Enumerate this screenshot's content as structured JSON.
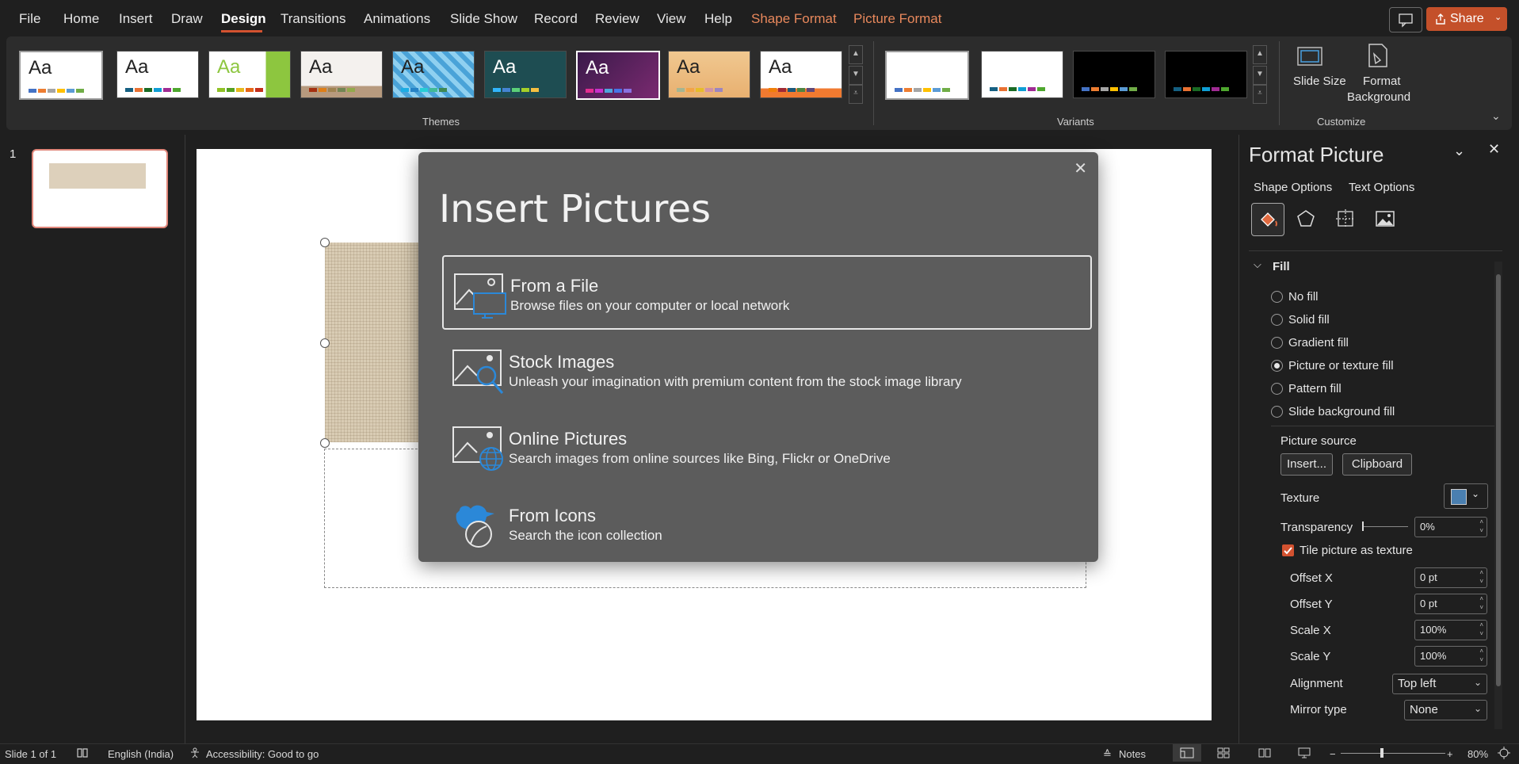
{
  "menu": {
    "items": [
      "File",
      "Home",
      "Insert",
      "Draw",
      "Design",
      "Transitions",
      "Animations",
      "Slide Show",
      "Record",
      "Review",
      "View",
      "Help"
    ],
    "contextual": [
      "Shape Format",
      "Picture Format"
    ],
    "active": "Design",
    "share_label": "Share"
  },
  "ribbon": {
    "themes_label": "Themes",
    "variants_label": "Variants",
    "customize_label": "Customize",
    "theme_aa": "Aa",
    "slide_size_label": "Slide Size",
    "format_background_label1": "Format",
    "format_background_label2": "Background"
  },
  "slides": {
    "number": "1"
  },
  "dialog": {
    "title": "Insert Pictures",
    "options": [
      {
        "title": "From a File",
        "desc": "Browse files on your computer or local network",
        "icon": "file-picture-icon"
      },
      {
        "title": "Stock Images",
        "desc": "Unleash your imagination with premium content from the stock image library",
        "icon": "stock-images-icon"
      },
      {
        "title": "Online Pictures",
        "desc": "Search images from online sources like Bing, Flickr or OneDrive",
        "icon": "online-pictures-icon"
      },
      {
        "title": "From Icons",
        "desc": "Search the icon collection",
        "icon": "icons-icon"
      }
    ]
  },
  "pane": {
    "title": "Format Picture",
    "shape_options": "Shape Options",
    "text_options": "Text Options",
    "fill_header": "Fill",
    "fills": [
      {
        "label": "No fill",
        "checked": false
      },
      {
        "label": "Solid fill",
        "checked": false
      },
      {
        "label": "Gradient fill",
        "checked": false
      },
      {
        "label": "Picture or texture fill",
        "checked": true
      },
      {
        "label": "Pattern fill",
        "checked": false
      },
      {
        "label": "Slide background fill",
        "checked": false
      }
    ],
    "picture_source": "Picture source",
    "insert_btn": "Insert...",
    "clipboard_btn": "Clipboard",
    "texture": "Texture",
    "transparency": "Transparency",
    "transparency_value": "0%",
    "tile_label": "Tile picture as texture",
    "offset_x": "Offset X",
    "offset_x_value": "0 pt",
    "offset_y": "Offset Y",
    "offset_y_value": "0 pt",
    "scale_x": "Scale X",
    "scale_x_value": "100%",
    "scale_y": "Scale Y",
    "scale_y_value": "100%",
    "alignment": "Alignment",
    "alignment_value": "Top left",
    "mirror": "Mirror type",
    "mirror_value": "None"
  },
  "status": {
    "slide": "Slide 1 of 1",
    "language": "English (India)",
    "accessibility": "Accessibility: Good to go",
    "notes": "Notes",
    "zoom": "80%"
  },
  "colors": {
    "accent": "#d35230",
    "dialog_bg": "#5c5c5c",
    "icon_blue": "#2b88d8"
  }
}
